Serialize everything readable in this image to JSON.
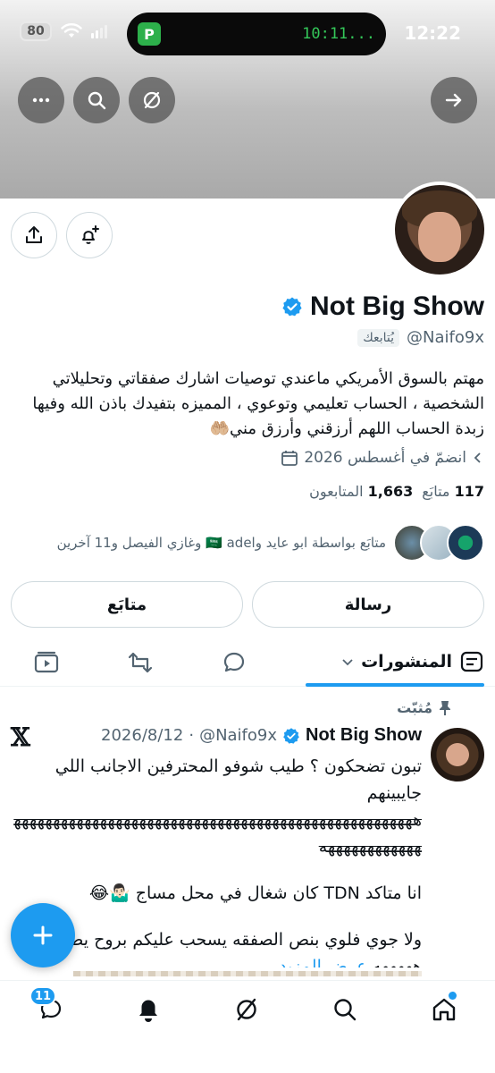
{
  "status_bar": {
    "battery": "80",
    "island_badge": "P",
    "island_timer": "10:11...",
    "time": "12:22"
  },
  "header_actions": {
    "more_icon": "ellipsis-icon",
    "search_icon": "search-icon",
    "grok_icon": "slash-circle-icon",
    "forward_icon": "arrow-right-icon"
  },
  "profile": {
    "name": "Not Big Show",
    "handle": "@Naifo9x",
    "follows_you": "يُتابعك",
    "bio": "مهتم بالسوق الأمريكي ماعندي توصيات اشارك صفقاتي وتحليلاتي الشخصية ، الحساب تعليمي وتوعوي ، المميزه بتفيدك باذن الله وفيها زبدة الحساب اللهم أرزقني وأرزق مني🤲🏼",
    "joined": "انضمّ في أغسطس 2026",
    "following_count": "117",
    "following_label": "متابَع",
    "followers_count": "1,663",
    "followers_label": "المتابعون",
    "followed_by": "متابَع بواسطة ابو عايد و🇸🇦 adel وغازي الفيصل و11 آخرين",
    "message_button": "رسالة",
    "following_button": "متابَع"
  },
  "tabs": {
    "posts_label": "المنشورات"
  },
  "pinned_post": {
    "pinned_label": "مُثبّت",
    "author_name": "Not Big Show",
    "author_handle": "@Naifo9x",
    "separator": "·",
    "date": "2026/8/12",
    "line1": "تبون تضحكون ؟ طيب شوفو المحترفين الاجانب اللي جايبينهم",
    "line2": "ههههههههههههههههههههههههههههههههههههههههههههههههههههههههههههههههه",
    "line3": "انا متاكد TDN كان شغال في محل مساج 🤷🏻‍♂️😂",
    "line4": "ولا جوي فلوي بنص الصفقه يسحب عليكم بروح يطلع يدلع",
    "line4_tail": "هههههه",
    "show_more": "عرض المزيد"
  },
  "bottom_nav": {
    "messages_badge": "11"
  },
  "colors": {
    "accent": "#1d9bf0",
    "text": "#0f1419",
    "muted": "#536471"
  }
}
